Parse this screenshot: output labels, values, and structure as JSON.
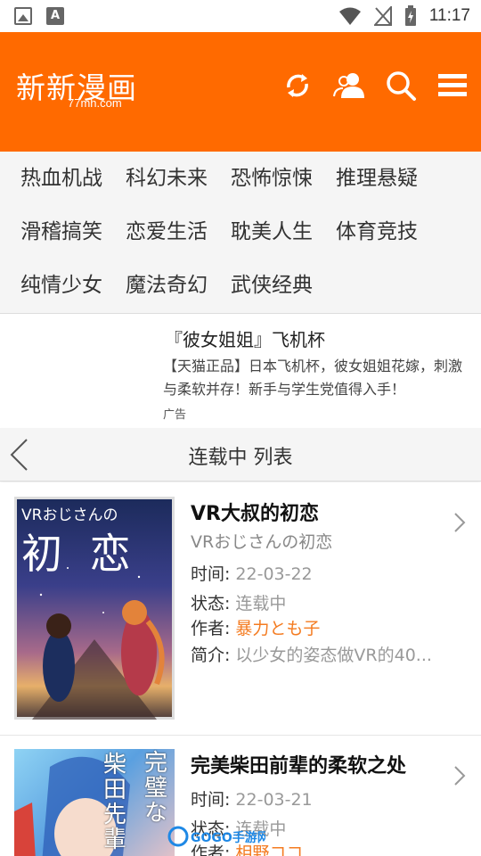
{
  "status_bar": {
    "time": "11:17"
  },
  "header": {
    "logo_main": "新新漫画",
    "logo_sub": "77mh.com",
    "brand_color": "#ff6a00"
  },
  "categories": [
    "热血机战",
    "科幻未来",
    "恐怖惊悚",
    "推理悬疑",
    "滑稽搞笑",
    "恋爱生活",
    "耽美人生",
    "体育竞技",
    "纯情少女",
    "魔法奇幻",
    "武侠经典"
  ],
  "ad": {
    "title": "『彼女姐姐』飞机杯",
    "desc": "【天猫正品】日本飞机杯，彼女姐姐花嫁，刺激与柔软并存！新手与学生党值得入手！",
    "tag": "广告"
  },
  "list_header": {
    "title": "连载中 列表"
  },
  "manga": [
    {
      "title": "VR大叔的初恋",
      "alt_title": "VRおじさんの初恋",
      "time_label": "时间:",
      "time": "22-03-22",
      "status_label": "状态:",
      "status": "连载中",
      "author_label": "作者:",
      "author": "暴力とも子",
      "intro_label": "简介:",
      "intro": "以少女的姿态做VR的40...",
      "cover_text_top": "VRおじさんの",
      "cover_text_big": "初 恋"
    },
    {
      "title": "完美柴田前辈的柔软之处",
      "time_label": "时间:",
      "time": "22-03-21",
      "status_label": "状态:",
      "status": "连载中",
      "author_label": "作者:",
      "author": "相野ココ",
      "cover_text_a": "完璧な",
      "cover_text_b": "柴田先輩"
    }
  ],
  "watermark": "GOGO手游网",
  "colors": {
    "accent": "#ff6a00",
    "author": "#f47b20"
  }
}
